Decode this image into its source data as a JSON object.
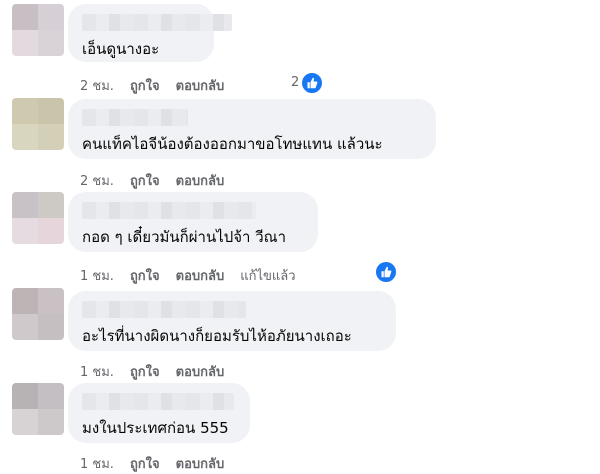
{
  "colors": {
    "accent": "#1877f2",
    "bubble": "#f0f2f5",
    "meta_text": "#65676b"
  },
  "actions": {
    "like": "ถูกใจ",
    "reply": "ตอบกลับ",
    "edited": "แก้ไขแล้ว"
  },
  "comments": [
    {
      "text": "เอ็นดูนางอะ",
      "time": "2 ชม.",
      "like_count": "2"
    },
    {
      "text": "คนแท็คไอจีน้องต้องออกมาขอโทษแทน แล้วนะ",
      "time": "2 ชม."
    },
    {
      "text": "กอด ๆ เดี๋ยวมันก็ผ่านไปจ้า วีณา",
      "time": "1 ชม."
    },
    {
      "text": "อะไรที่นางผิดนางก็ยอมรับไห้อภัยนางเถอะ",
      "time": "1 ชม."
    },
    {
      "text": "มงในประเทศก่อน 555",
      "time": "1 ชม."
    }
  ]
}
